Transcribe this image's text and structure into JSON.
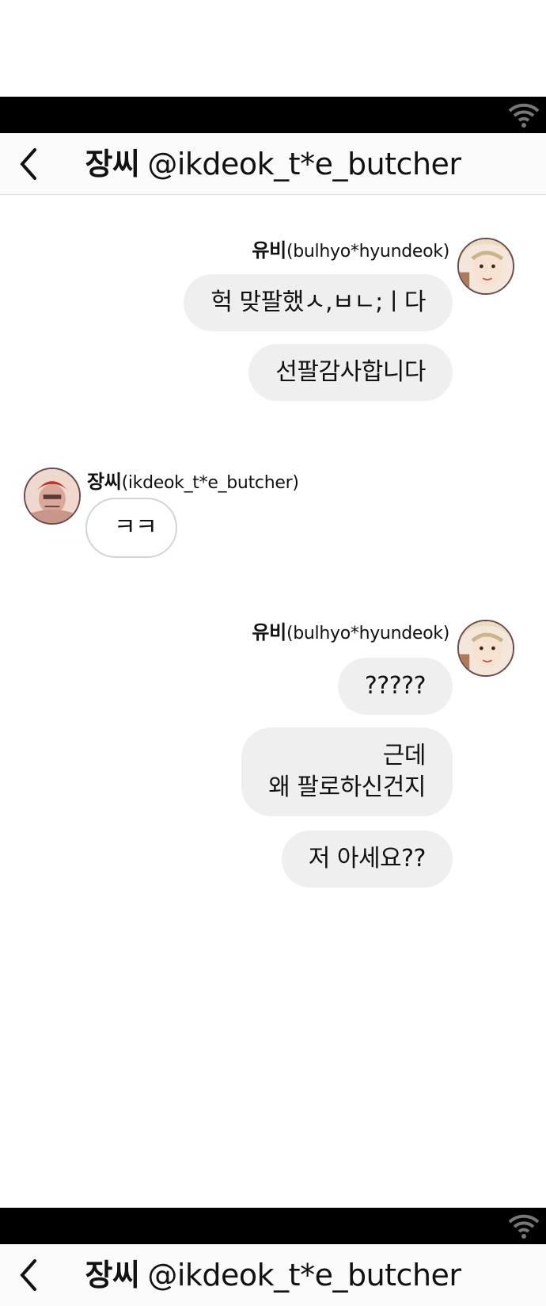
{
  "header": {
    "name": "장씨",
    "handle": "@ikdeok_t*e_butcher"
  },
  "icons": {
    "wifi": "wifi-icon",
    "back": "chevron-left-icon"
  },
  "colors": {
    "status_bar": "#000000",
    "bubble_outgoing": "#efefef",
    "bubble_incoming_border": "#d4d4d4"
  },
  "messages": [
    {
      "sender_name": "유비",
      "sender_handle": "(bulhyo*hyundeok)",
      "bubbles": [
        "헉 맞팔했ㅅ,ㅂㄴ;ㅣ다",
        "선팔감사합니다"
      ]
    },
    {
      "sender_name": "장씨",
      "sender_handle": "(ikdeok_t*e_butcher)",
      "bubbles": [
        "ㅋㅋ"
      ]
    },
    {
      "sender_name": "유비",
      "sender_handle": "(bulhyo*hyundeok)",
      "bubbles": [
        "?????",
        "근데\n왜 팔로하신건지",
        "저 아세요??"
      ]
    }
  ]
}
